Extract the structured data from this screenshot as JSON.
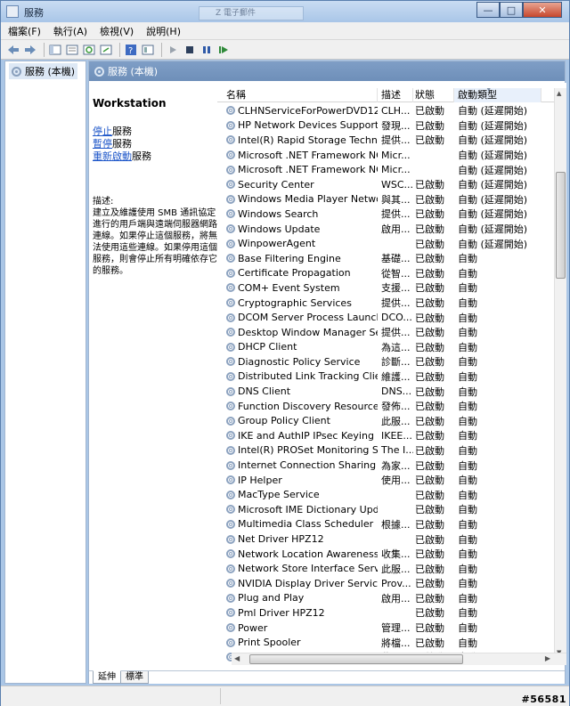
{
  "window": {
    "title": "服務",
    "ghost_tab": "Z 電子郵件",
    "buttons": {
      "minimize": "—",
      "maximize": "□",
      "close": "✕"
    }
  },
  "menu": [
    "檔案(F)",
    "執行(A)",
    "檢視(V)",
    "說明(H)"
  ],
  "toolbar": {
    "icons": [
      "back-arrow-icon",
      "forward-arrow-icon",
      "console-tree-icon",
      "show-hide-icon",
      "refresh-icon",
      "export-list-icon",
      "help-icon",
      "properties-icon",
      "start-service-icon",
      "stop-service-icon",
      "pause-service-icon",
      "restart-service-icon"
    ]
  },
  "tree": {
    "item": "服務 (本機)"
  },
  "pane": {
    "header": "服務 (本機)",
    "selected_service": "Workstation",
    "actions": [
      {
        "link": "停止",
        "suffix": "服務"
      },
      {
        "link": "暫停",
        "suffix": "服務"
      },
      {
        "link": "重新啟動",
        "suffix": "服務"
      }
    ],
    "desc_label": "描述:",
    "desc_text": "建立及維護使用 SMB 通訊協定進行的用戶端與遠端伺服器網路連線。如果停止這個服務，將無法使用這些連線。如果停用這個服務，則會停止所有明確依存它的服務。"
  },
  "list": {
    "columns": [
      "名稱",
      "描述",
      "狀態",
      "啟動類型"
    ],
    "rows": [
      [
        "CLHNServiceForPowerDVD12",
        "CLH...",
        "已啟動",
        "自動 (延遲開始)"
      ],
      [
        "HP Network Devices Support",
        "發現...",
        "已啟動",
        "自動 (延遲開始)"
      ],
      [
        "Intel(R) Rapid Storage Technol...",
        "提供...",
        "已啟動",
        "自動 (延遲開始)"
      ],
      [
        "Microsoft .NET Framework NGE...",
        "Micr...",
        "",
        "自動 (延遲開始)"
      ],
      [
        "Microsoft .NET Framework NGE...",
        "Micr...",
        "",
        "自動 (延遲開始)"
      ],
      [
        "Security Center",
        "WSC...",
        "已啟動",
        "自動 (延遲開始)"
      ],
      [
        "Windows Media Player Networ...",
        "與其...",
        "已啟動",
        "自動 (延遲開始)"
      ],
      [
        "Windows Search",
        "提供...",
        "已啟動",
        "自動 (延遲開始)"
      ],
      [
        "Windows Update",
        "啟用...",
        "已啟動",
        "自動 (延遲開始)"
      ],
      [
        "WinpowerAgent",
        "",
        "已啟動",
        "自動 (延遲開始)"
      ],
      [
        "Base Filtering Engine",
        "基礎...",
        "已啟動",
        "自動"
      ],
      [
        "Certificate Propagation",
        "從智...",
        "已啟動",
        "自動"
      ],
      [
        "COM+ Event System",
        "支援...",
        "已啟動",
        "自動"
      ],
      [
        "Cryptographic Services",
        "提供...",
        "已啟動",
        "自動"
      ],
      [
        "DCOM Server Process Launcher",
        "DCO...",
        "已啟動",
        "自動"
      ],
      [
        "Desktop Window Manager Ses...",
        "提供...",
        "已啟動",
        "自動"
      ],
      [
        "DHCP Client",
        "為這...",
        "已啟動",
        "自動"
      ],
      [
        "Diagnostic Policy Service",
        "診斷...",
        "已啟動",
        "自動"
      ],
      [
        "Distributed Link Tracking Client",
        "維護...",
        "已啟動",
        "自動"
      ],
      [
        "DNS Client",
        "DNS...",
        "已啟動",
        "自動"
      ],
      [
        "Function Discovery Resource P...",
        "發佈...",
        "已啟動",
        "自動"
      ],
      [
        "Group Policy Client",
        "此服...",
        "已啟動",
        "自動"
      ],
      [
        "IKE and AuthIP IPsec Keying Mo...",
        "IKEE...",
        "已啟動",
        "自動"
      ],
      [
        "Intel(R) PROSet Monitoring Ser...",
        "The I...",
        "已啟動",
        "自動"
      ],
      [
        "Internet Connection Sharing (IC...",
        "為家...",
        "已啟動",
        "自動"
      ],
      [
        "IP Helper",
        "使用...",
        "已啟動",
        "自動"
      ],
      [
        "MacType Service",
        "",
        "已啟動",
        "自動"
      ],
      [
        "Microsoft IME Dictionary Update",
        "",
        "已啟動",
        "自動"
      ],
      [
        "Multimedia Class Scheduler",
        "根據...",
        "已啟動",
        "自動"
      ],
      [
        "Net Driver HPZ12",
        "",
        "已啟動",
        "自動"
      ],
      [
        "Network Location Awareness",
        "收集...",
        "已啟動",
        "自動"
      ],
      [
        "Network Store Interface Service",
        "此服...",
        "已啟動",
        "自動"
      ],
      [
        "NVIDIA Display Driver Service",
        "Prov...",
        "已啟動",
        "自動"
      ],
      [
        "Plug and Play",
        "啟用...",
        "已啟動",
        "自動"
      ],
      [
        "Pml Driver HPZ12",
        "",
        "已啟動",
        "自動"
      ],
      [
        "Power",
        "管理...",
        "已啟動",
        "自動"
      ],
      [
        "Print Spooler",
        "將檔...",
        "已啟動",
        "自動"
      ],
      [
        "Program Compatibility Assistan...",
        "此服...",
        "已啟動",
        "自動"
      ]
    ]
  },
  "tabs": [
    "延伸",
    "標準"
  ],
  "watermark": "#56581"
}
